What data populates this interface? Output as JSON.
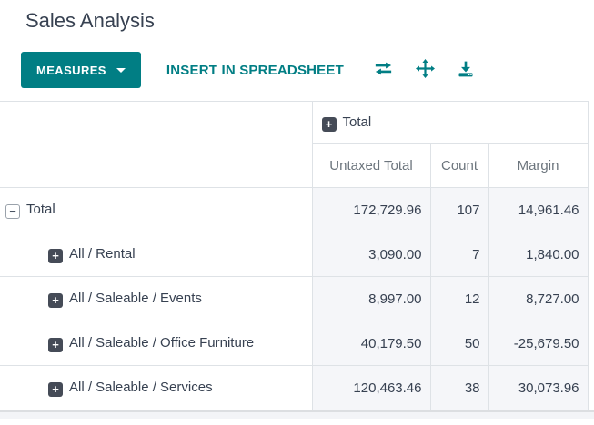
{
  "page": {
    "title": "Sales Analysis"
  },
  "toolbar": {
    "measures_label": "MEASURES",
    "insert_label": "INSERT IN SPREADSHEET",
    "icons": [
      "flip-axis-icon",
      "expand-all-icon",
      "download-icon"
    ]
  },
  "colors": {
    "accent_teal": "#017e84",
    "text_dark": "#374151",
    "text_muted": "#6c757d",
    "border": "#dee2e6",
    "cell_bg": "#f5f6f9"
  },
  "pivot": {
    "column_group": {
      "label": "Total",
      "state": "collapsed"
    },
    "measures": [
      "Untaxed Total",
      "Count",
      "Margin"
    ],
    "rows": [
      {
        "label": "Total",
        "state": "expanded",
        "untaxed_total": "172,729.96",
        "count": "107",
        "margin": "14,961.46"
      },
      {
        "label": "All / Rental",
        "state": "collapsed",
        "untaxed_total": "3,090.00",
        "count": "7",
        "margin": "1,840.00"
      },
      {
        "label": "All / Saleable / Events",
        "state": "collapsed",
        "untaxed_total": "8,997.00",
        "count": "12",
        "margin": "8,727.00"
      },
      {
        "label": "All / Saleable / Office Furniture",
        "state": "collapsed",
        "untaxed_total": "40,179.50",
        "count": "50",
        "margin": "-25,679.50"
      },
      {
        "label": "All / Saleable / Services",
        "state": "collapsed",
        "untaxed_total": "120,463.46",
        "count": "38",
        "margin": "30,073.96"
      }
    ]
  }
}
